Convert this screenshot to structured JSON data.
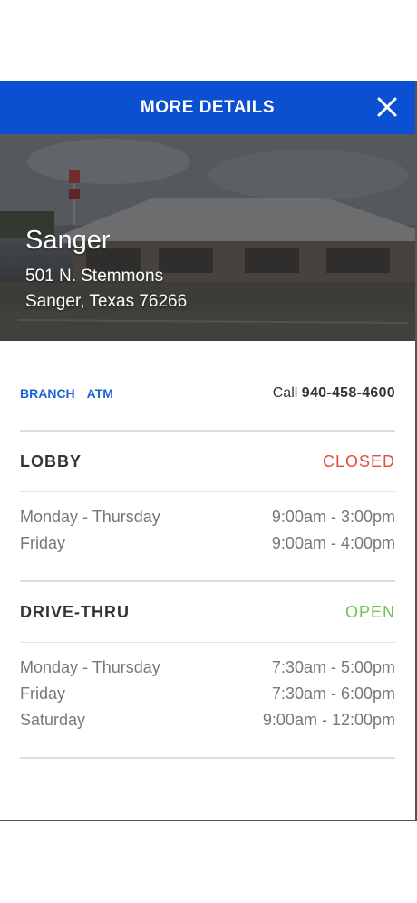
{
  "header": {
    "title": "MORE DETAILS",
    "close_icon": "close-icon"
  },
  "branch": {
    "name": "Sanger",
    "address_line1": "501 N. Stemmons",
    "address_line2": "Sanger, Texas 76266"
  },
  "services": {
    "branch_label": "BRANCH",
    "atm_label": "ATM"
  },
  "contact": {
    "call_label": "Call",
    "phone": "940-458-4600"
  },
  "lobby": {
    "title": "LOBBY",
    "status": "CLOSED",
    "hours": [
      {
        "days": "Monday - Thursday",
        "time": "9:00am - 3:00pm"
      },
      {
        "days": "Friday",
        "time": "9:00am - 4:00pm"
      }
    ]
  },
  "drive_thru": {
    "title": "DRIVE-THRU",
    "status": "OPEN",
    "hours": [
      {
        "days": "Monday - Thursday",
        "time": "7:30am - 5:00pm"
      },
      {
        "days": "Friday",
        "time": "7:30am - 6:00pm"
      },
      {
        "days": "Saturday",
        "time": "9:00am - 12:00pm"
      }
    ]
  },
  "colors": {
    "header_bg": "#0b50d0",
    "link_blue": "#1f63d6",
    "closed_red": "#e24b3f",
    "open_green": "#6cc24a"
  }
}
